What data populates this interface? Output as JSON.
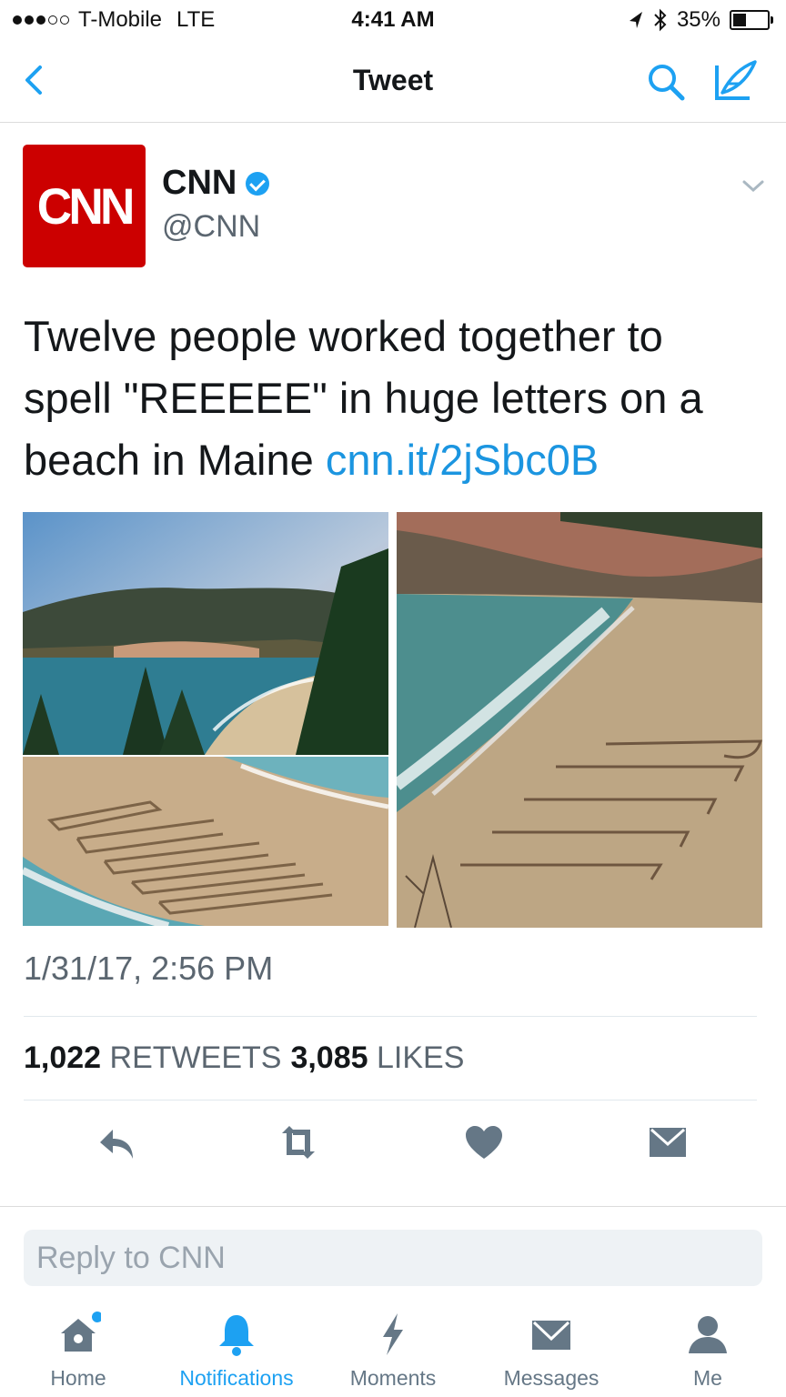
{
  "status_bar": {
    "carrier": "T-Mobile",
    "network": "LTE",
    "time": "4:41 AM",
    "battery": "35%"
  },
  "nav": {
    "title": "Tweet"
  },
  "tweet": {
    "author_name": "CNN",
    "author_handle": "@CNN",
    "avatar_text": "CNN",
    "text": "Twelve people worked together to spell \"REEEEE\" in huge letters on a beach in Maine ",
    "link": "cnn.it/2jSbc0B",
    "timestamp": "1/31/17, 2:56 PM",
    "retweets_count": "1,022",
    "retweets_label": "RETWEETS",
    "likes_count": "3,085",
    "likes_label": "LIKES"
  },
  "reply": {
    "placeholder": "Reply to CNN"
  },
  "tabs": [
    {
      "label": "Home",
      "icon": "home-icon"
    },
    {
      "label": "Notifications",
      "icon": "bell-icon"
    },
    {
      "label": "Moments",
      "icon": "lightning-icon"
    },
    {
      "label": "Messages",
      "icon": "envelope-icon"
    },
    {
      "label": "Me",
      "icon": "person-icon"
    }
  ],
  "colors": {
    "accent": "#1da1f2",
    "link": "#1b95e0",
    "cnn_red": "#cc0000",
    "muted": "#5b6670"
  }
}
